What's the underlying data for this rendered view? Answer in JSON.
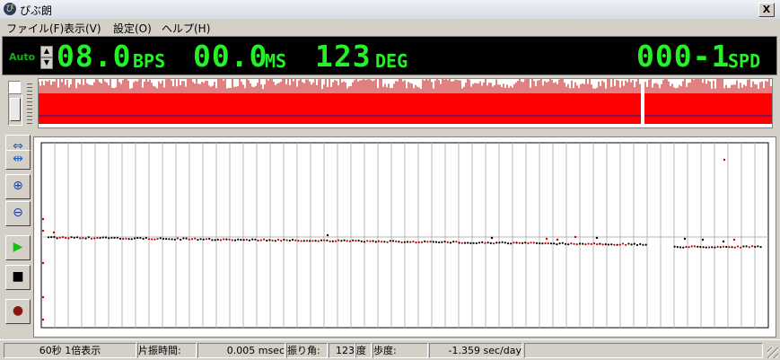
{
  "window": {
    "title": "ぴぶ朗",
    "app_icon_glyph": "ぴ",
    "close_glyph": "X"
  },
  "menu": [
    {
      "label": "ファイル(F)"
    },
    {
      "label": "表示(V)"
    },
    {
      "label": "設定(O)"
    },
    {
      "label": "ヘルプ(H)"
    }
  ],
  "display": {
    "auto_label": "Auto",
    "bph": "08.0",
    "bph_unit": "BPS",
    "ms": "00.0",
    "ms_unit": "MS",
    "amp": "123",
    "amp_unit": "DEG",
    "rate": "000-1",
    "rate_unit": "SPD",
    "lcd_color": "#26f026"
  },
  "tools": [
    {
      "name": "expand-h-icon",
      "glyph": "⇔",
      "color": "#1a63c4"
    },
    {
      "name": "compress-h-icon",
      "glyph": "⇹",
      "color": "#1a63c4"
    },
    {
      "name": "zoom-in-icon",
      "glyph": "⊕",
      "color": "#1a3f9c"
    },
    {
      "name": "zoom-out-icon",
      "glyph": "⊖",
      "color": "#1a3f9c"
    },
    {
      "name": "play-icon",
      "glyph": "▶",
      "color": "#12c412"
    },
    {
      "name": "stop-icon",
      "glyph": "■",
      "color": "#000000"
    },
    {
      "name": "record-icon",
      "glyph": "●",
      "color": "#8a1414"
    }
  ],
  "status": {
    "zoom_text": "60秒 1倍表示",
    "beat_error_label": "片振時間:",
    "beat_error_value": "0.005 msec",
    "amplitude_label": "振り角:",
    "amplitude_value": "123",
    "amplitude_unit": "度",
    "rate_label": "歩度:",
    "rate_value": "-1.359 sec/day"
  },
  "colors": {
    "strip_fill": "#ff0000",
    "strip_line": "#1a1aa0",
    "point_a": "#000000",
    "point_b": "#cc0000"
  }
}
